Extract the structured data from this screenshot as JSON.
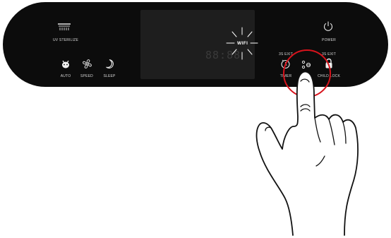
{
  "controls": {
    "uv_sterilize": {
      "label": "UV STERILIZE",
      "icon": "uv-lamp-icon"
    },
    "auto": {
      "label": "AUTO",
      "icon": "auto-bug-icon"
    },
    "speed": {
      "label": "SPEED",
      "icon": "fan-icon"
    },
    "sleep": {
      "label": "SLEEP",
      "icon": "moon-icon"
    },
    "timer": {
      "label": "TIMER",
      "sublabel": "3S EXIT",
      "icon": "timer-icon"
    },
    "wifi_button": {
      "icon": "wifi-mode-icon"
    },
    "child_lock": {
      "label": "CHILD LOCK",
      "sublabel": "3S EXIT",
      "icon": "lock-icon"
    },
    "power": {
      "label": "POWER",
      "icon": "power-icon"
    }
  },
  "display": {
    "digits": "88:88",
    "wifi_label": "WIFI"
  },
  "colors": {
    "panel": "#0c0c0c",
    "display": "#1e1e1e",
    "highlight_ring": "#d8131c",
    "label": "#d8d8d8"
  }
}
